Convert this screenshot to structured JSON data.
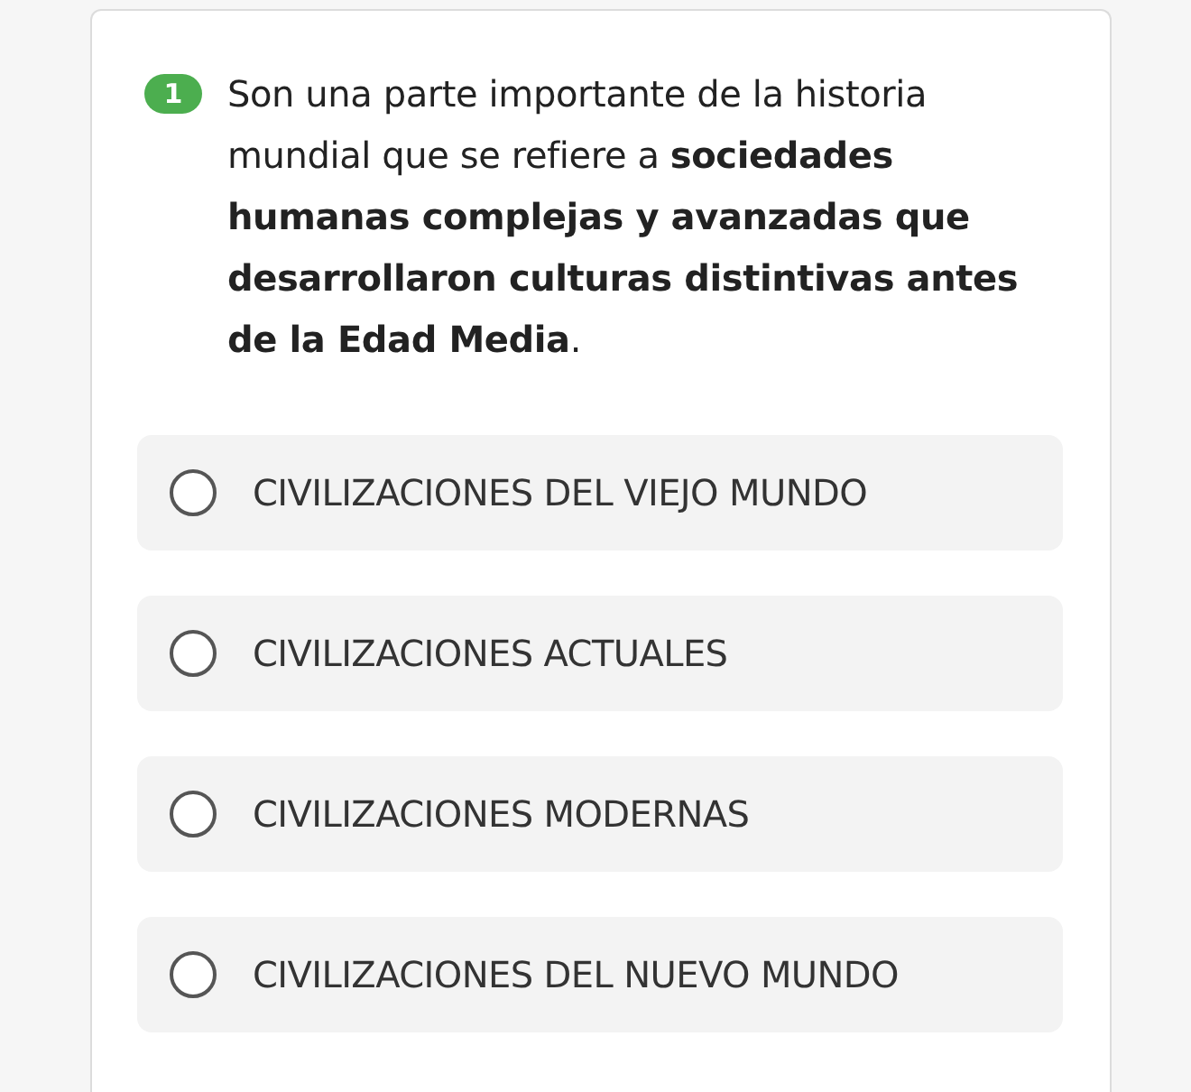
{
  "question": {
    "number": "1",
    "text": "Son una parte importante de la historia mundial que se refiere a **sociedades humanas complejas y avanzadas que desarrollaron culturas distintivas antes de la Edad Media**."
  },
  "options": [
    {
      "label": "CIVILIZACIONES DEL VIEJO MUNDO",
      "selected": false
    },
    {
      "label": "CIVILIZACIONES ACTUALES",
      "selected": false
    },
    {
      "label": "CIVILIZACIONES MODERNAS",
      "selected": false
    },
    {
      "label": "CIVILIZACIONES DEL NUEVO MUNDO",
      "selected": false
    }
  ]
}
